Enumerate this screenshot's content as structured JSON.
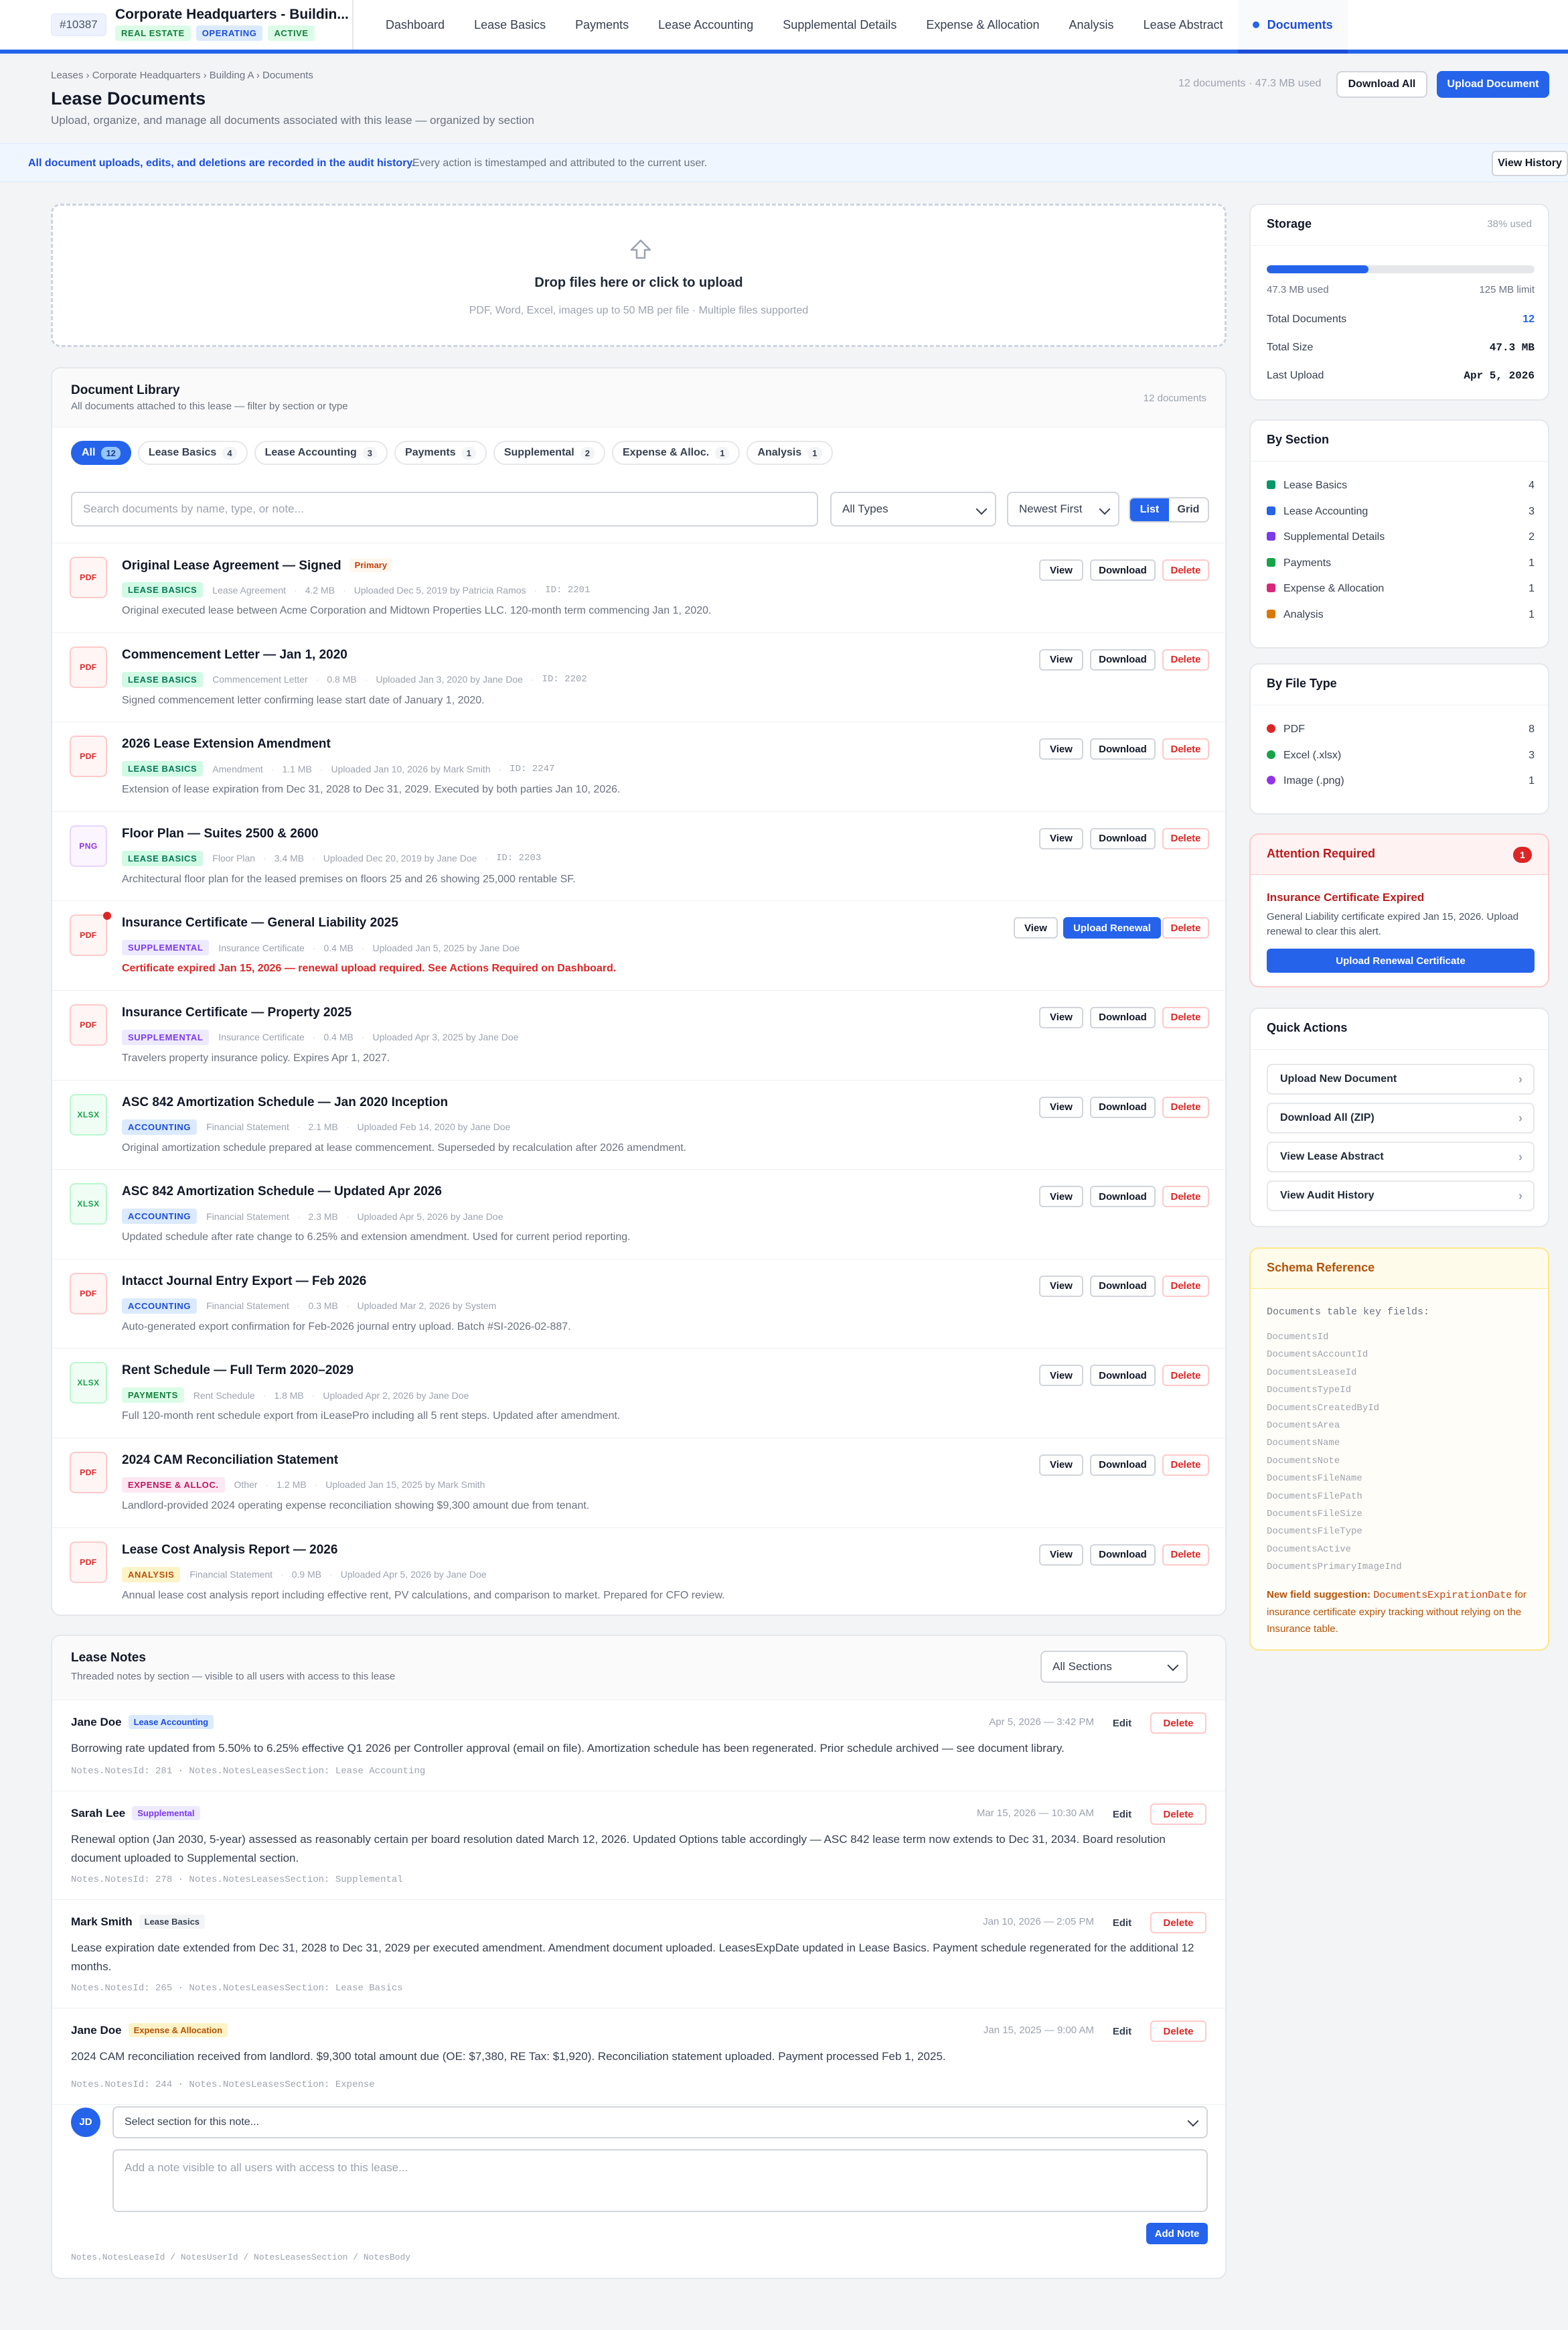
{
  "app": {
    "lease_id": "#10387",
    "title": "Corporate Headquarters - Buildin...",
    "tags": [
      "REAL ESTATE",
      "OPERATING",
      "ACTIVE"
    ]
  },
  "nav": [
    "Dashboard",
    "Lease Basics",
    "Payments",
    "Lease Accounting",
    "Supplemental Details",
    "Expense & Allocation",
    "Analysis",
    "Lease Abstract",
    "Documents"
  ],
  "header": {
    "breadcrumb": "Leases › Corporate Headquarters › Building A › Documents",
    "title": "Lease Documents",
    "subtitle": "Upload, organize, and manage all documents associated with this lease — organized by section",
    "doc_meta": "12 documents · 47.3 MB used",
    "download_all": "Download All",
    "upload": "Upload Document"
  },
  "banner": {
    "bold": "All document uploads, edits, and deletions are recorded in the audit history.",
    "text": "Every action is timestamped and attributed to the current user.",
    "button": "View History"
  },
  "dropzone": {
    "icon": "upload-icon",
    "title": "Drop files here or click to upload",
    "subtitle": "PDF, Word, Excel, images up to 50 MB per file · Multiple files supported"
  },
  "library": {
    "title": "Document Library",
    "subtitle": "All documents attached to this lease — filter by section or type",
    "count": "12 documents",
    "filters": [
      {
        "label": "All",
        "count": "12"
      },
      {
        "label": "Lease Basics",
        "count": "4"
      },
      {
        "label": "Lease Accounting",
        "count": "3"
      },
      {
        "label": "Payments",
        "count": "1"
      },
      {
        "label": "Supplemental",
        "count": "2"
      },
      {
        "label": "Expense & Alloc.",
        "count": "1"
      },
      {
        "label": "Analysis",
        "count": "1"
      }
    ],
    "search_placeholder": "Search documents by name, type, or note...",
    "type_select": "All Types",
    "sort_select": "Newest First",
    "view_list": "List",
    "view_grid": "Grid",
    "btn_view": "View",
    "btn_download": "Download",
    "btn_delete": "Delete",
    "btn_upload_renewal": "Upload Renewal",
    "primary_badge": "Primary",
    "docs": [
      {
        "ext": "PDF",
        "name": "Original Lease Agreement — Signed",
        "primary": true,
        "section": "LEASE BASICS",
        "sclass": "s-lb",
        "type": "Lease Agreement",
        "size": "4.2 MB",
        "uploaded": "Uploaded Dec 5, 2019 by Patricia Ramos",
        "id": "ID: 2201",
        "desc": "Original executed lease between Acme Corporation and Midtown Properties LLC. 120-month term commencing Jan 1, 2020."
      },
      {
        "ext": "PDF",
        "name": "Commencement Letter — Jan 1, 2020",
        "section": "LEASE BASICS",
        "sclass": "s-lb",
        "type": "Commencement Letter",
        "size": "0.8 MB",
        "uploaded": "Uploaded Jan 3, 2020 by Jane Doe",
        "id": "ID: 2202",
        "desc": "Signed commencement letter confirming lease start date of January 1, 2020."
      },
      {
        "ext": "PDF",
        "name": "2026 Lease Extension Amendment",
        "section": "LEASE BASICS",
        "sclass": "s-lb",
        "type": "Amendment",
        "size": "1.1 MB",
        "uploaded": "Uploaded Jan 10, 2026 by Mark Smith",
        "id": "ID: 2247",
        "desc": "Extension of lease expiration from Dec 31, 2028 to Dec 31, 2029. Executed by both parties Jan 10, 2026."
      },
      {
        "ext": "PNG",
        "name": "Floor Plan — Suites 2500 & 2600",
        "section": "LEASE BASICS",
        "sclass": "s-lb",
        "type": "Floor Plan",
        "size": "3.4 MB",
        "uploaded": "Uploaded Dec 20, 2019 by Jane Doe",
        "id": "ID: 2203",
        "desc": "Architectural floor plan for the leased premises on floors 25 and 26 showing 25,000 rentable SF."
      },
      {
        "ext": "PDF",
        "name": "Insurance Certificate — General Liability 2025",
        "alert": true,
        "section": "SUPPLEMENTAL",
        "sclass": "s-su",
        "type": "Insurance Certificate",
        "size": "0.4 MB",
        "uploaded": "Uploaded Jan 5, 2025 by Jane Doe",
        "id": "",
        "desc": "Certificate expired Jan 15, 2026 — renewal upload required. See Actions Required on Dashboard."
      },
      {
        "ext": "PDF",
        "name": "Insurance Certificate — Property 2025",
        "section": "SUPPLEMENTAL",
        "sclass": "s-su",
        "type": "Insurance Certificate",
        "size": "0.4 MB",
        "uploaded": "Uploaded Apr 3, 2025 by Jane Doe",
        "id": "",
        "desc": "Travelers property insurance policy. Expires Apr 1, 2027."
      },
      {
        "ext": "XLSX",
        "name": "ASC 842 Amortization Schedule — Jan 2020 Inception",
        "section": "ACCOUNTING",
        "sclass": "s-ac",
        "type": "Financial Statement",
        "size": "2.1 MB",
        "uploaded": "Uploaded Feb 14, 2020 by Jane Doe",
        "id": "",
        "desc": "Original amortization schedule prepared at lease commencement. Superseded by recalculation after 2026 amendment."
      },
      {
        "ext": "XLSX",
        "name": "ASC 842 Amortization Schedule — Updated Apr 2026",
        "section": "ACCOUNTING",
        "sclass": "s-ac",
        "type": "Financial Statement",
        "size": "2.3 MB",
        "uploaded": "Uploaded Apr 5, 2026 by Jane Doe",
        "id": "",
        "desc": "Updated schedule after rate change to 6.25% and extension amendment. Used for current period reporting."
      },
      {
        "ext": "PDF",
        "name": "Intacct Journal Entry Export — Feb 2026",
        "section": "ACCOUNTING",
        "sclass": "s-ac",
        "type": "Financial Statement",
        "size": "0.3 MB",
        "uploaded": "Uploaded Mar 2, 2026 by System",
        "id": "",
        "desc": "Auto-generated export confirmation for Feb-2026 journal entry upload. Batch #SI-2026-02-887."
      },
      {
        "ext": "XLSX",
        "name": "Rent Schedule — Full Term 2020–2029",
        "section": "PAYMENTS",
        "sclass": "s-pa",
        "type": "Rent Schedule",
        "size": "1.8 MB",
        "uploaded": "Uploaded Apr 2, 2026 by Jane Doe",
        "id": "",
        "desc": "Full 120-month rent schedule export from iLeasePro including all 5 rent steps. Updated after amendment."
      },
      {
        "ext": "PDF",
        "name": "2024 CAM Reconciliation Statement",
        "section": "EXPENSE & ALLOC.",
        "sclass": "s-ex",
        "type": "Other",
        "size": "1.2 MB",
        "uploaded": "Uploaded Jan 15, 2025 by Mark Smith",
        "id": "",
        "desc": "Landlord-provided 2024 operating expense reconciliation showing $9,300 amount due from tenant."
      },
      {
        "ext": "PDF",
        "name": "Lease Cost Analysis Report — 2026",
        "section": "ANALYSIS",
        "sclass": "s-an",
        "type": "Financial Statement",
        "size": "0.9 MB",
        "uploaded": "Uploaded Apr 5, 2026 by Jane Doe",
        "id": "",
        "desc": "Annual lease cost analysis report including effective rent, PV calculations, and comparison to market. Prepared for CFO review."
      }
    ]
  },
  "notes": {
    "title": "Lease Notes",
    "subtitle": "Threaded notes by section — visible to all users with access to this lease",
    "filter": "All Sections",
    "btn_edit": "Edit",
    "btn_delete": "Delete",
    "items": [
      {
        "author": "Jane Doe",
        "section": "Lease Accounting",
        "time": "Apr 5, 2026 — 3:42 PM",
        "body": "Borrowing rate updated from 5.50% to 6.25% effective Q1 2026 per Controller approval (email on file). Amortization schedule has been regenerated. Prior schedule archived — see document library.",
        "foot": "Notes.NotesId: 281 · Notes.NotesLeasesSection: Lease Accounting"
      },
      {
        "author": "Sarah Lee",
        "section": "Supplemental",
        "time": "Mar 15, 2026 — 10:30 AM",
        "body": "Renewal option (Jan 2030, 5-year) assessed as reasonably certain per board resolution dated March 12, 2026. Updated Options table accordingly — ASC 842 lease term now extends to Dec 31, 2034. Board resolution document uploaded to Supplemental section.",
        "foot": "Notes.NotesId: 278 · Notes.NotesLeasesSection: Supplemental"
      },
      {
        "author": "Mark Smith",
        "section": "Lease Basics",
        "time": "Jan 10, 2026 — 2:05 PM",
        "body": "Lease expiration date extended from Dec 31, 2028 to Dec 31, 2029 per executed amendment. Amendment document uploaded. LeasesExpDate updated in Lease Basics. Payment schedule regenerated for the additional 12 months.",
        "foot": "Notes.NotesId: 265 · Notes.NotesLeasesSection: Lease Basics"
      },
      {
        "author": "Jane Doe",
        "section": "Expense & Allocation",
        "time": "Jan 15, 2025 — 9:00 AM",
        "body": "2024 CAM reconciliation received from landlord. $9,300 total amount due (OE: $7,380, RE Tax: $1,920). Reconciliation statement uploaded. Payment processed Feb 1, 2025.",
        "foot": "Notes.NotesId: 244 · Notes.NotesLeasesSection: Expense"
      }
    ],
    "avatar": "JD",
    "section_select": "Select section for this note...",
    "note_placeholder": "Add a note visible to all users with access to this lease...",
    "add_button": "Add Note",
    "schema_footer": "Notes.NotesLeaseId / NotesUserId / NotesLeasesSection / NotesBody"
  },
  "storage": {
    "title": "Storage",
    "pct_label": "38% used",
    "used_fraction": 0.38,
    "used": "47.3 MB used",
    "limit": "125 MB limit",
    "rows": [
      {
        "label": "Total Documents",
        "value": "12"
      },
      {
        "label": "Total Size",
        "value": "47.3 MB"
      },
      {
        "label": "Last Upload",
        "value": "Apr 5, 2026"
      }
    ]
  },
  "by_section": {
    "title": "By Section",
    "items": [
      {
        "label": "Lease Basics",
        "count": "4",
        "color": "#059669"
      },
      {
        "label": "Lease Accounting",
        "count": "3",
        "color": "#2563eb"
      },
      {
        "label": "Supplemental Details",
        "count": "2",
        "color": "#7c3aed"
      },
      {
        "label": "Payments",
        "count": "1",
        "color": "#16a34a"
      },
      {
        "label": "Expense & Allocation",
        "count": "1",
        "color": "#db2777"
      },
      {
        "label": "Analysis",
        "count": "1",
        "color": "#d97706"
      }
    ]
  },
  "by_type": {
    "title": "By File Type",
    "items": [
      {
        "label": "PDF",
        "count": "8",
        "color": "#dc2626"
      },
      {
        "label": "Excel (.xlsx)",
        "count": "3",
        "color": "#16a34a"
      },
      {
        "label": "Image (.png)",
        "count": "1",
        "color": "#9333ea"
      }
    ]
  },
  "attention": {
    "title": "Attention Required",
    "count": "1",
    "item_title": "Insurance Certificate Expired",
    "item_body": "General Liability certificate expired Jan 15, 2026. Upload renewal to clear this alert.",
    "button": "Upload Renewal Certificate"
  },
  "quick_actions": {
    "title": "Quick Actions",
    "items": [
      "Upload New Document",
      "Download All (ZIP)",
      "View Lease Abstract",
      "View Audit History"
    ]
  },
  "schema": {
    "title": "Schema Reference",
    "heading": "Documents table key fields:",
    "fields": [
      "DocumentsId",
      "DocumentsAccountId",
      "DocumentsLeaseId",
      "DocumentsTypeId",
      "DocumentsCreatedById",
      "DocumentsArea",
      "DocumentsName",
      "DocumentsNote",
      "DocumentsFileName",
      "DocumentsFilePath",
      "DocumentsFileSize",
      "DocumentsFileType",
      "DocumentsActive",
      "DocumentsPrimaryImageInd"
    ],
    "suggestion_label": "New field suggestion:",
    "suggestion_field": "DocumentsExpirationDate",
    "suggestion_text": "for insurance certificate expiry tracking without relying on the Insurance table."
  }
}
